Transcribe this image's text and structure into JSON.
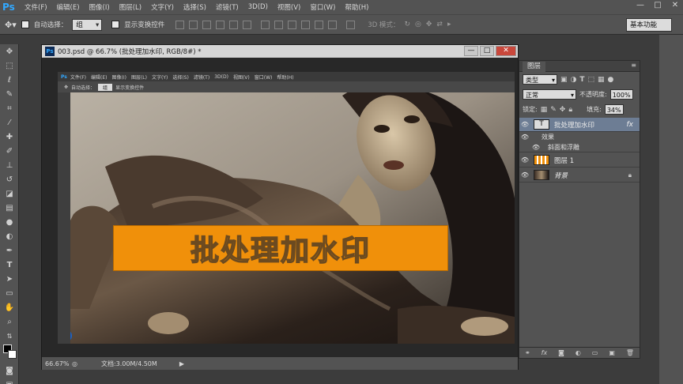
{
  "app": {
    "logo": "Ps",
    "menu": [
      "文件(F)",
      "编辑(E)",
      "图像(I)",
      "图层(L)",
      "文字(Y)",
      "选择(S)",
      "滤镜(T)",
      "3D(D)",
      "视图(V)",
      "窗口(W)",
      "帮助(H)"
    ],
    "window_controls": [
      "—",
      "□",
      "✕"
    ]
  },
  "options": {
    "auto_select_label": "自动选择：",
    "auto_select_value": "组",
    "show_transform_label": "显示变换控件",
    "mode_3d_label": "3D 模式：",
    "workspace": "基本功能"
  },
  "document": {
    "title": "003.psd @ 66.7% (批处理加水印, RGB/8#) *",
    "zoom": "66.67%",
    "doc_size": "文档:3.00M/4.50M",
    "watermark_text": "批处理加水印",
    "inner_menu": [
      "文件(F)",
      "编辑(E)",
      "图像(I)",
      "图层(L)",
      "文字(Y)",
      "选择(S)",
      "滤镜(T)",
      "3D(D)",
      "视图(V)",
      "窗口(W)",
      "帮助(H)"
    ],
    "inner_auto_select": "自动选择：",
    "inner_group": "组",
    "inner_show_transform": "显示变换控件"
  },
  "layers_panel": {
    "tab": "图层",
    "kind_filter": "类型",
    "blend_mode": "正常",
    "opacity_label": "不透明度:",
    "opacity_value": "100%",
    "lock_label": "锁定:",
    "fill_label": "填充:",
    "fill_value": "34%",
    "layers": [
      {
        "name": "批处理加水印",
        "type": "text",
        "fx": "fx",
        "selected": true
      },
      {
        "name": "效果",
        "type": "effects"
      },
      {
        "name": "斜面和浮雕",
        "type": "effect"
      },
      {
        "name": "图层 1",
        "type": "pixel"
      },
      {
        "name": "背景",
        "type": "background"
      }
    ],
    "footer_fx": "fx"
  },
  "colors": {
    "chrome": "#535353",
    "watermark_fill": "#f0900a",
    "selected_layer": "#6d7d94"
  }
}
